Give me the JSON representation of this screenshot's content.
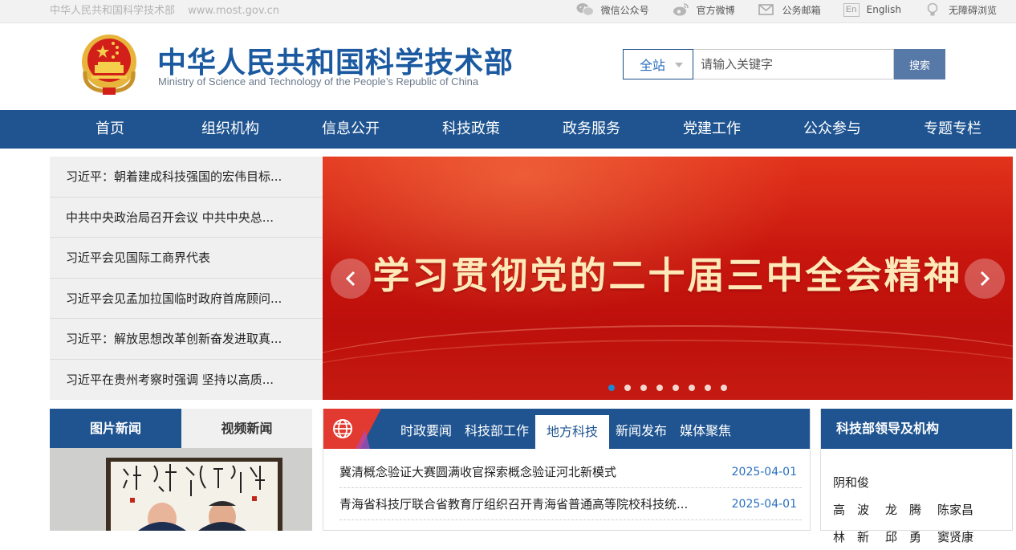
{
  "topbar": {
    "site_name": "中华人民共和国科学技术部",
    "site_url": "www.most.gov.cn",
    "links": [
      {
        "label": "微信公众号",
        "icon": "wechat-icon"
      },
      {
        "label": "官方微博",
        "icon": "weibo-icon"
      },
      {
        "label": "公务邮箱",
        "icon": "mail-icon"
      },
      {
        "label": "English",
        "icon": "english-icon",
        "icon_text": "En"
      },
      {
        "label": "无障碍浏览",
        "icon": "accessibility-icon"
      }
    ]
  },
  "header": {
    "title_cn": "中华人民共和国科学技术部",
    "title_en": "Ministry of Science and Technology of the People’s Republic of China"
  },
  "search": {
    "scope": "全站",
    "placeholder": "请输入关键字",
    "button": "搜索"
  },
  "nav": [
    "首页",
    "组织机构",
    "信息公开",
    "科技政策",
    "政务服务",
    "党建工作",
    "公众参与",
    "专题专栏"
  ],
  "headlines": [
    "习近平：朝着建成科技强国的宏伟目标...",
    "中共中央政治局召开会议 中共中央总...",
    "习近平会见国际工商界代表",
    "习近平会见孟加拉国临时政府首席顾问...",
    "习近平：解放思想改革创新奋发进取真...",
    "习近平在贵州考察时强调 坚持以高质..."
  ],
  "banner": {
    "title": "学习贯彻党的二十届三中全会精神",
    "slide_count": 8,
    "active_slide": 1
  },
  "media_tabs": [
    "图片新闻",
    "视频新闻"
  ],
  "news": {
    "tabs": [
      "时政要闻",
      "科技部工作",
      "地方科技",
      "新闻发布",
      "媒体聚焦"
    ],
    "active_tab": "地方科技",
    "items": [
      {
        "title": "冀清概念验证大赛圆满收官探索概念验证河北新模式",
        "date": "2025-04-01"
      },
      {
        "title": "青海省科技厅联合省教育厅组织召开青海省普通高等院校科技统...",
        "date": "2025-04-01"
      }
    ]
  },
  "leaders": {
    "title": "科技部领导及机构",
    "names": [
      [
        "阴和俊"
      ],
      [
        "高　波",
        "龙　腾",
        "陈家昌"
      ],
      [
        "林　新",
        "邱　勇",
        "窦贤康"
      ]
    ]
  },
  "colors": {
    "nav_blue": "#1f5490",
    "brand_blue": "#1b5aa0",
    "banner_red": "#c8160e",
    "banner_text": "#ffe9b8",
    "link_blue": "#2a6fbf"
  }
}
